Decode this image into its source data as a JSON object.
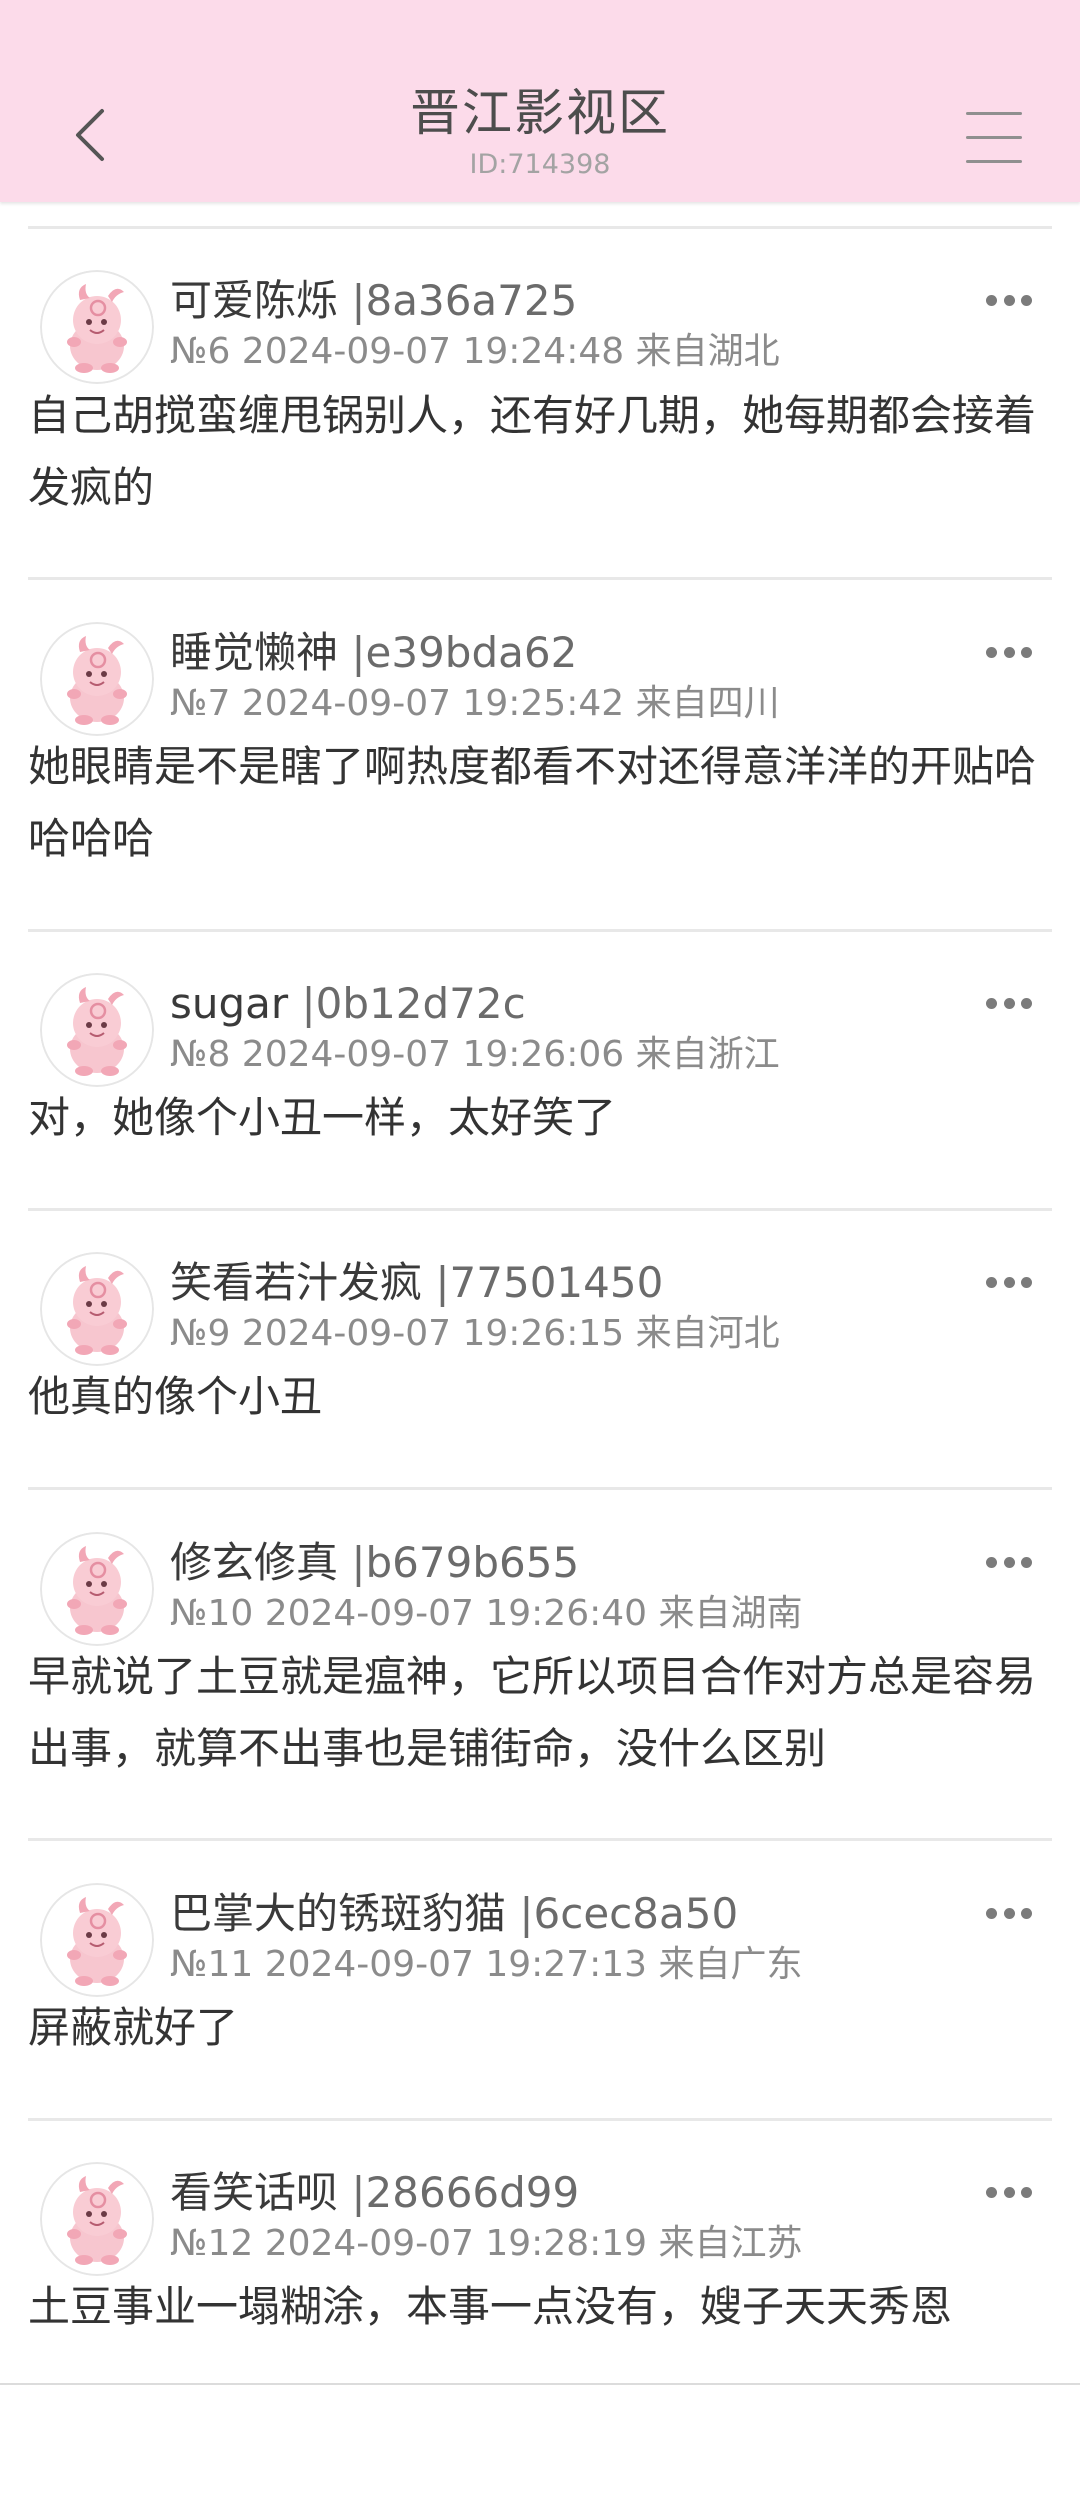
{
  "header": {
    "title": "晋江影视区",
    "subtitle": "ID:714398",
    "background": "#fcdbea"
  },
  "posts": [
    {
      "username": "可爱陈烁",
      "uid": "|8a36a725",
      "meta": "№6 2024-09-07 19:24:48 来自湖北",
      "text": "自己胡搅蛮缠甩锅别人，还有好几期，她每期都会接着发疯的"
    },
    {
      "username": "睡觉懒神",
      "uid": "|e39bda62",
      "meta": "№7 2024-09-07 19:25:42 来自四川",
      "text": "她眼睛是不是瞎了啊热度都看不对还得意洋洋的开贴哈哈哈哈"
    },
    {
      "username": "sugar",
      "uid": "|0b12d72c",
      "meta": "№8 2024-09-07 19:26:06 来自浙江",
      "text": "对，她像个小丑一样，太好笑了"
    },
    {
      "username": "笑看若汁发疯",
      "uid": "|77501450",
      "meta": "№9 2024-09-07 19:26:15 来自河北",
      "text": "他真的像个小丑"
    },
    {
      "username": "修玄修真",
      "uid": "|b679b655",
      "meta": "№10 2024-09-07 19:26:40 来自湖南",
      "text": "早就说了土豆就是瘟神，它所以项目合作对方总是容易出事，就算不出事也是铺街命，没什么区别"
    },
    {
      "username": "巴掌大的锈斑豹猫",
      "uid": "|6cec8a50",
      "meta": "№11 2024-09-07 19:27:13 来自广东",
      "text": "屏蔽就好了"
    },
    {
      "username": "看笑话呗",
      "uid": "|28666d99",
      "meta": "№12 2024-09-07 19:28:19 来自江苏",
      "text": "土豆事业一塌糊涂，本事一点没有，嫂子天天秀恩"
    }
  ]
}
